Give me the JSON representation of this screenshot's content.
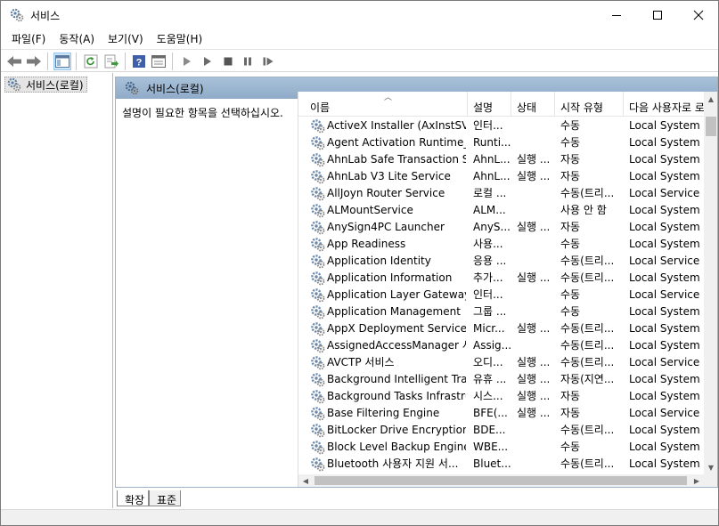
{
  "window": {
    "title": "서비스"
  },
  "menu": [
    "파일(F)",
    "동작(A)",
    "보기(V)",
    "도움말(H)"
  ],
  "tree": {
    "root_label": "서비스(로컬)"
  },
  "content": {
    "header_label": "서비스(로컬)",
    "description_prompt": "설명이 필요한 항목을 선택하십시오."
  },
  "columns": {
    "name": "이름",
    "desc": "설명",
    "status": "상태",
    "startup": "시작 유형",
    "logon": "다음 사용자로 로"
  },
  "services": [
    {
      "name": "ActiveX Installer (AxInstSV)",
      "desc": "인터...",
      "status": "",
      "startup": "수동",
      "logon": "Local System"
    },
    {
      "name": "Agent Activation Runtime_...",
      "desc": "Runti...",
      "status": "",
      "startup": "수동",
      "logon": "Local System"
    },
    {
      "name": "AhnLab Safe Transaction S...",
      "desc": "AhnL...",
      "status": "실행 ...",
      "startup": "자동",
      "logon": "Local System"
    },
    {
      "name": "AhnLab V3 Lite Service",
      "desc": "AhnL...",
      "status": "실행 ...",
      "startup": "자동",
      "logon": "Local System"
    },
    {
      "name": "AllJoyn Router Service",
      "desc": "로컬 ...",
      "status": "",
      "startup": "수동(트리...",
      "logon": "Local Service"
    },
    {
      "name": "ALMountService",
      "desc": "ALM...",
      "status": "",
      "startup": "사용 안 함",
      "logon": "Local System"
    },
    {
      "name": "AnySign4PC Launcher",
      "desc": "AnyS...",
      "status": "실행 ...",
      "startup": "자동",
      "logon": "Local System"
    },
    {
      "name": "App Readiness",
      "desc": "사용...",
      "status": "",
      "startup": "수동",
      "logon": "Local System"
    },
    {
      "name": "Application Identity",
      "desc": "응용 ...",
      "status": "",
      "startup": "수동(트리...",
      "logon": "Local Service"
    },
    {
      "name": "Application Information",
      "desc": "추가...",
      "status": "실행 ...",
      "startup": "수동(트리...",
      "logon": "Local System"
    },
    {
      "name": "Application Layer Gateway ...",
      "desc": "인터...",
      "status": "",
      "startup": "수동",
      "logon": "Local Service"
    },
    {
      "name": "Application Management",
      "desc": "그룹 ...",
      "status": "",
      "startup": "수동",
      "logon": "Local System"
    },
    {
      "name": "AppX Deployment Service ...",
      "desc": "Micr...",
      "status": "실행 ...",
      "startup": "수동(트리...",
      "logon": "Local System"
    },
    {
      "name": "AssignedAccessManager 서...",
      "desc": "Assig...",
      "status": "",
      "startup": "수동(트리...",
      "logon": "Local System"
    },
    {
      "name": "AVCTP 서비스",
      "desc": "오디...",
      "status": "실행 ...",
      "startup": "수동(트리...",
      "logon": "Local Service"
    },
    {
      "name": "Background Intelligent Tra...",
      "desc": "유휴 ...",
      "status": "실행 ...",
      "startup": "자동(지연...",
      "logon": "Local System"
    },
    {
      "name": "Background Tasks Infrastru...",
      "desc": "시스...",
      "status": "실행 ...",
      "startup": "자동",
      "logon": "Local System"
    },
    {
      "name": "Base Filtering Engine",
      "desc": "BFE(...",
      "status": "실행 ...",
      "startup": "자동",
      "logon": "Local Service"
    },
    {
      "name": "BitLocker Drive Encryption ...",
      "desc": "BDE...",
      "status": "",
      "startup": "수동(트리...",
      "logon": "Local System"
    },
    {
      "name": "Block Level Backup Engine ...",
      "desc": "WBE...",
      "status": "",
      "startup": "수동",
      "logon": "Local System"
    },
    {
      "name": "Bluetooth 사용자 지원 서...",
      "desc": "Bluet...",
      "status": "",
      "startup": "수동(트리...",
      "logon": "Local System"
    }
  ],
  "tabs": [
    "확장",
    "표준"
  ]
}
